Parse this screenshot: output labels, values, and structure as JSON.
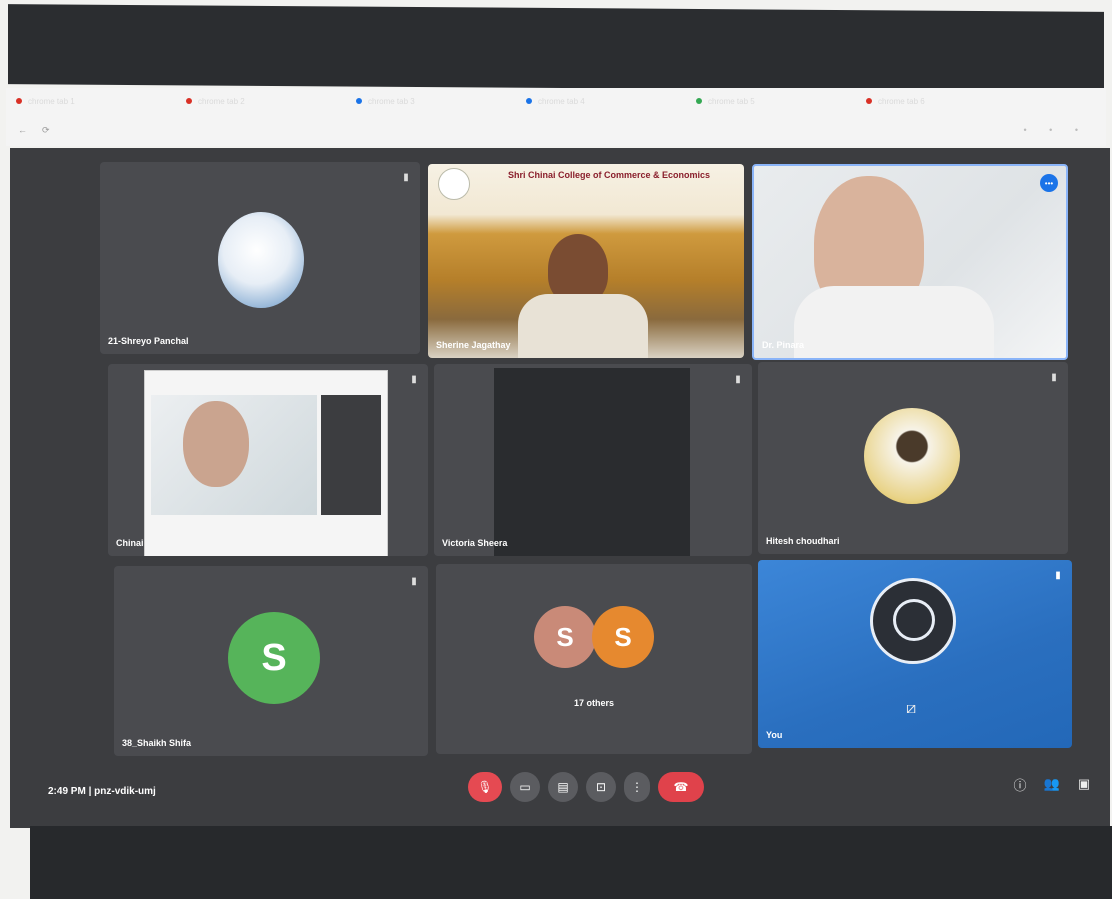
{
  "browser": {
    "tabs": [
      {
        "label": "chrome tab 1",
        "color": "#d93025"
      },
      {
        "label": "chrome tab 2",
        "color": "#d93025"
      },
      {
        "label": "chrome tab 3",
        "color": "#1a73e8"
      },
      {
        "label": "chrome tab 4",
        "color": "#1a73e8"
      },
      {
        "label": "chrome tab 5",
        "color": "#34a853"
      },
      {
        "label": "chrome tab 6",
        "color": "#d93025"
      }
    ],
    "url": ""
  },
  "meeting": {
    "time": "2:49 PM",
    "code": "pnz-vdik-umj",
    "participants": [
      {
        "name": "21-Shreyo Panchal"
      },
      {
        "name": "Sherine Jagathay",
        "banner_title": "Shri Chinai College of Commerce & Economics"
      },
      {
        "name": "Dr. Pinara"
      },
      {
        "name": "Chinai"
      },
      {
        "name": "Victoria Sheera"
      },
      {
        "name": "Hitesh choudhari"
      },
      {
        "name": "38_Shaikh Shifa",
        "initial": "S"
      },
      {
        "name": "17 others",
        "initials": [
          "S",
          "S"
        ]
      },
      {
        "name": "You"
      }
    ]
  },
  "colors": {
    "green_avatar": "#56b45a",
    "others_avatar_1": "#c98a78",
    "others_avatar_2": "#e6892f",
    "leave_red": "#e0424b",
    "mic_red": "#e54a52",
    "you_blue": "#2e7fd1"
  },
  "controls": {
    "mic_icon": "mic-off-icon",
    "camera_icon": "camera-icon",
    "captions_icon": "captions-icon",
    "present_icon": "present-icon",
    "more_icon": "more-icon",
    "leave_icon": "phone-hangup-icon"
  }
}
